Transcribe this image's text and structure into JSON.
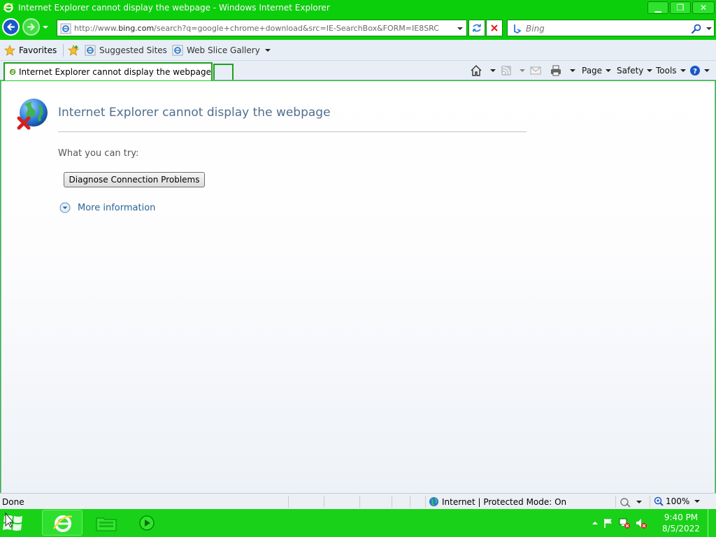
{
  "window": {
    "title": "Internet Explorer cannot display the webpage - Windows Internet Explorer",
    "controls": {
      "minimize": "▁",
      "maximize": "❐",
      "close": "✕"
    }
  },
  "address_bar": {
    "url_prefix": "http://www.",
    "url_domain": "bing.com",
    "url_rest": "/search?q=google+chrome+download&src=IE-SearchBox&FORM=IE8SRC"
  },
  "search": {
    "placeholder": "Bing"
  },
  "favorites_bar": {
    "favorites_label": "Favorites",
    "links": [
      "Suggested Sites",
      "Web Slice Gallery"
    ]
  },
  "tab": {
    "label": "Internet Explorer cannot display the webpage"
  },
  "command_bar": {
    "page": "Page",
    "safety": "Safety",
    "tools": "Tools"
  },
  "content": {
    "title": "Internet Explorer cannot display the webpage",
    "try_label": "What you can try:",
    "diagnose_button": "Diagnose Connection Problems",
    "more_info": "More information"
  },
  "status_bar": {
    "status": "Done",
    "zone": "Internet | Protected Mode: On",
    "zoom": "100%"
  },
  "taskbar": {
    "time": "9:40 PM",
    "date": "8/5/2022"
  },
  "colors": {
    "chrome_green": "#0ccf0c",
    "taskbar_green": "#19d119",
    "error_title": "#4e6f8f",
    "link_blue": "#2a6496"
  },
  "icons": [
    "ie-logo-icon",
    "back-arrow-icon",
    "forward-arrow-icon",
    "refresh-icon",
    "stop-icon",
    "search-magnifier-icon",
    "star-icon",
    "add-favorite-icon",
    "home-icon",
    "rss-feed-icon",
    "mail-icon",
    "print-icon",
    "help-icon",
    "globe-error-icon",
    "expand-circle-icon",
    "globe-icon",
    "zoom-icon",
    "windows-start-icon",
    "folder-icon",
    "media-player-icon",
    "flag-icon",
    "network-icon",
    "volume-muted-icon"
  ]
}
